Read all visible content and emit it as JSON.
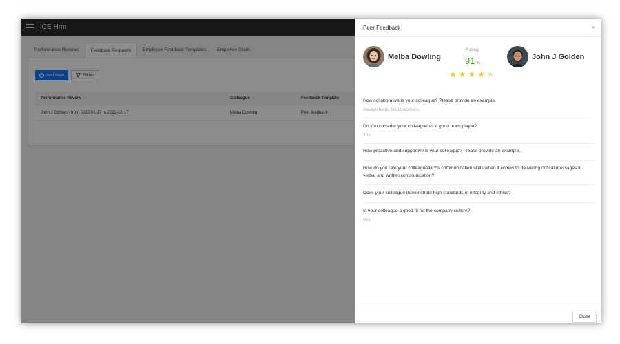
{
  "app": {
    "title": "ICE Hrm",
    "tabs": [
      "Performance Reviews",
      "Feedback Requests",
      "Employee Feedback Templates",
      "Employee Goals"
    ],
    "active_tab": 1,
    "buttons": {
      "add_new": "Add New",
      "filters": "Filters"
    },
    "table": {
      "headers": [
        "Performance Review",
        "Colleague",
        "Feedback Template"
      ],
      "rows": [
        [
          "John J Golden - from 2022-01-17 to 2022-02-17",
          "Melba Dowling",
          "Peer feedback"
        ]
      ]
    }
  },
  "drawer": {
    "title": "Peer Feedback",
    "close_icon": "×",
    "left_person": {
      "name": "Melba Dowling"
    },
    "right_person": {
      "name": "John J Golden"
    },
    "rating": {
      "label": "Rating",
      "value": "91",
      "unit": "%",
      "stars": 4.5,
      "star_color": "#f5c518",
      "value_color": "#3aa526"
    },
    "questions": [
      {
        "q": "How collaborative is your colleague? Please provide an example.",
        "a": "Always helps his coworkers."
      },
      {
        "q": "Do you consider your colleague as a good team player?",
        "a": "Yes"
      },
      {
        "q": "How proactive and supportive is your colleague? Please provide an example.",
        "a": ""
      },
      {
        "q": "How do you rate your colleagueâ€™s communication skills when it comes to delivering critical messages in verbal and written communication?",
        "a": ""
      },
      {
        "q": "Does your colleague demonstrate high standards of integrity and ethics?",
        "a": ""
      },
      {
        "q": "Is your colleague a good fit for the company culture?",
        "a": "yes"
      }
    ],
    "footer": {
      "close_label": "Close"
    }
  },
  "colors": {
    "primary": "#1677ff",
    "topbar": "#2c2c2c"
  }
}
